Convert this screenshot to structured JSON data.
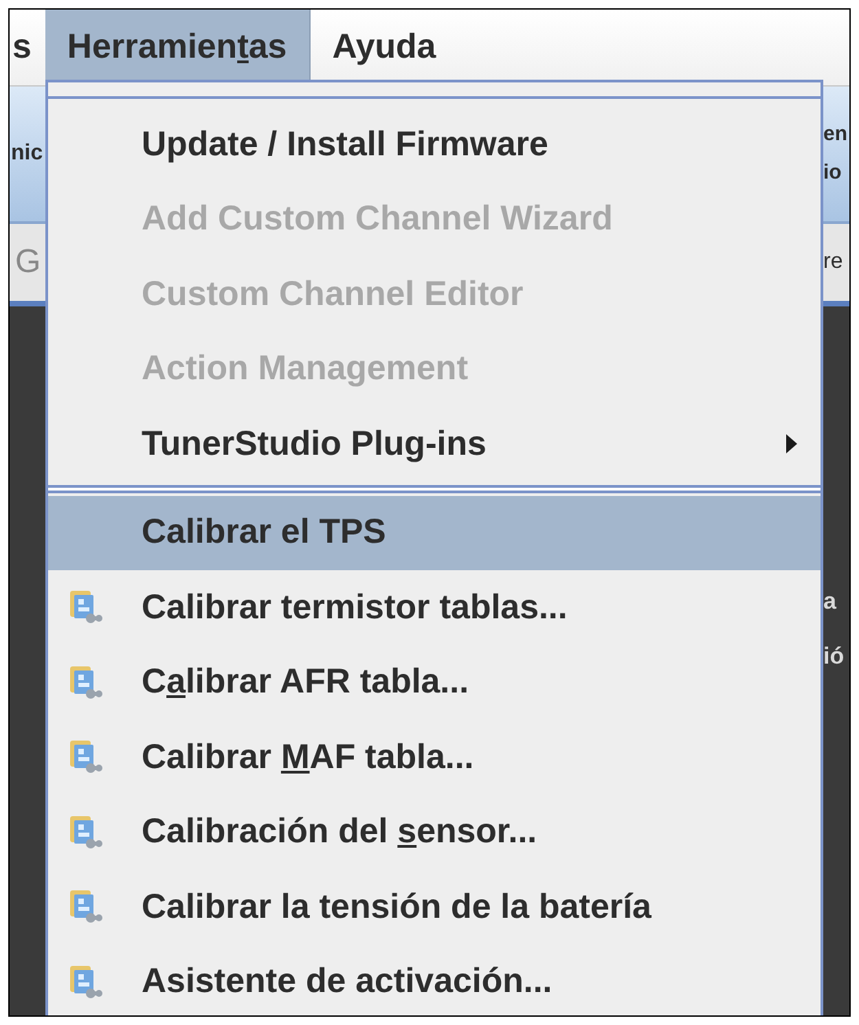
{
  "menu_bar": [
    {
      "pre": "s",
      "selected": false
    },
    {
      "pre": "Herramien",
      "key": "t",
      "post": "as",
      "selected": true
    },
    {
      "pre": "Ayuda",
      "selected": false
    }
  ],
  "background": {
    "left": [
      "nic",
      "G"
    ],
    "right": [
      "en",
      "io",
      "re",
      "a",
      "ió"
    ]
  },
  "menu": [
    {
      "kind": "plain",
      "pre": "Update / Install Firmware",
      "disabled": false,
      "selected": false
    },
    {
      "kind": "plain",
      "pre": "Add Custom Channel Wizard",
      "disabled": true,
      "selected": false
    },
    {
      "kind": "plain",
      "pre": "Custom Channel Editor",
      "disabled": true,
      "selected": false
    },
    {
      "kind": "plain",
      "pre": "Action Management",
      "disabled": true,
      "selected": false
    },
    {
      "kind": "submenu",
      "pre": "TunerStudio Plug-ins",
      "disabled": false,
      "selected": false
    },
    {
      "kind": "separator"
    },
    {
      "kind": "plain",
      "pre": "Calibrar el TPS",
      "disabled": false,
      "selected": true
    },
    {
      "kind": "icon",
      "pre": "Calibrar termistor tablas...",
      "disabled": false,
      "selected": false
    },
    {
      "kind": "icon",
      "pre": "C",
      "key": "a",
      "post": "librar AFR tabla...",
      "disabled": false,
      "selected": false
    },
    {
      "kind": "icon",
      "pre": "Calibrar ",
      "key": "M",
      "post": "AF tabla...",
      "disabled": false,
      "selected": false
    },
    {
      "kind": "icon",
      "pre": "Calibración del ",
      "key": "s",
      "post": "ensor...",
      "disabled": false,
      "selected": false
    },
    {
      "kind": "icon",
      "pre": "Calibrar la tensión de la batería",
      "disabled": false,
      "selected": false
    },
    {
      "kind": "icon",
      "pre": "Asistente de activación...",
      "disabled": false,
      "selected": false
    }
  ]
}
